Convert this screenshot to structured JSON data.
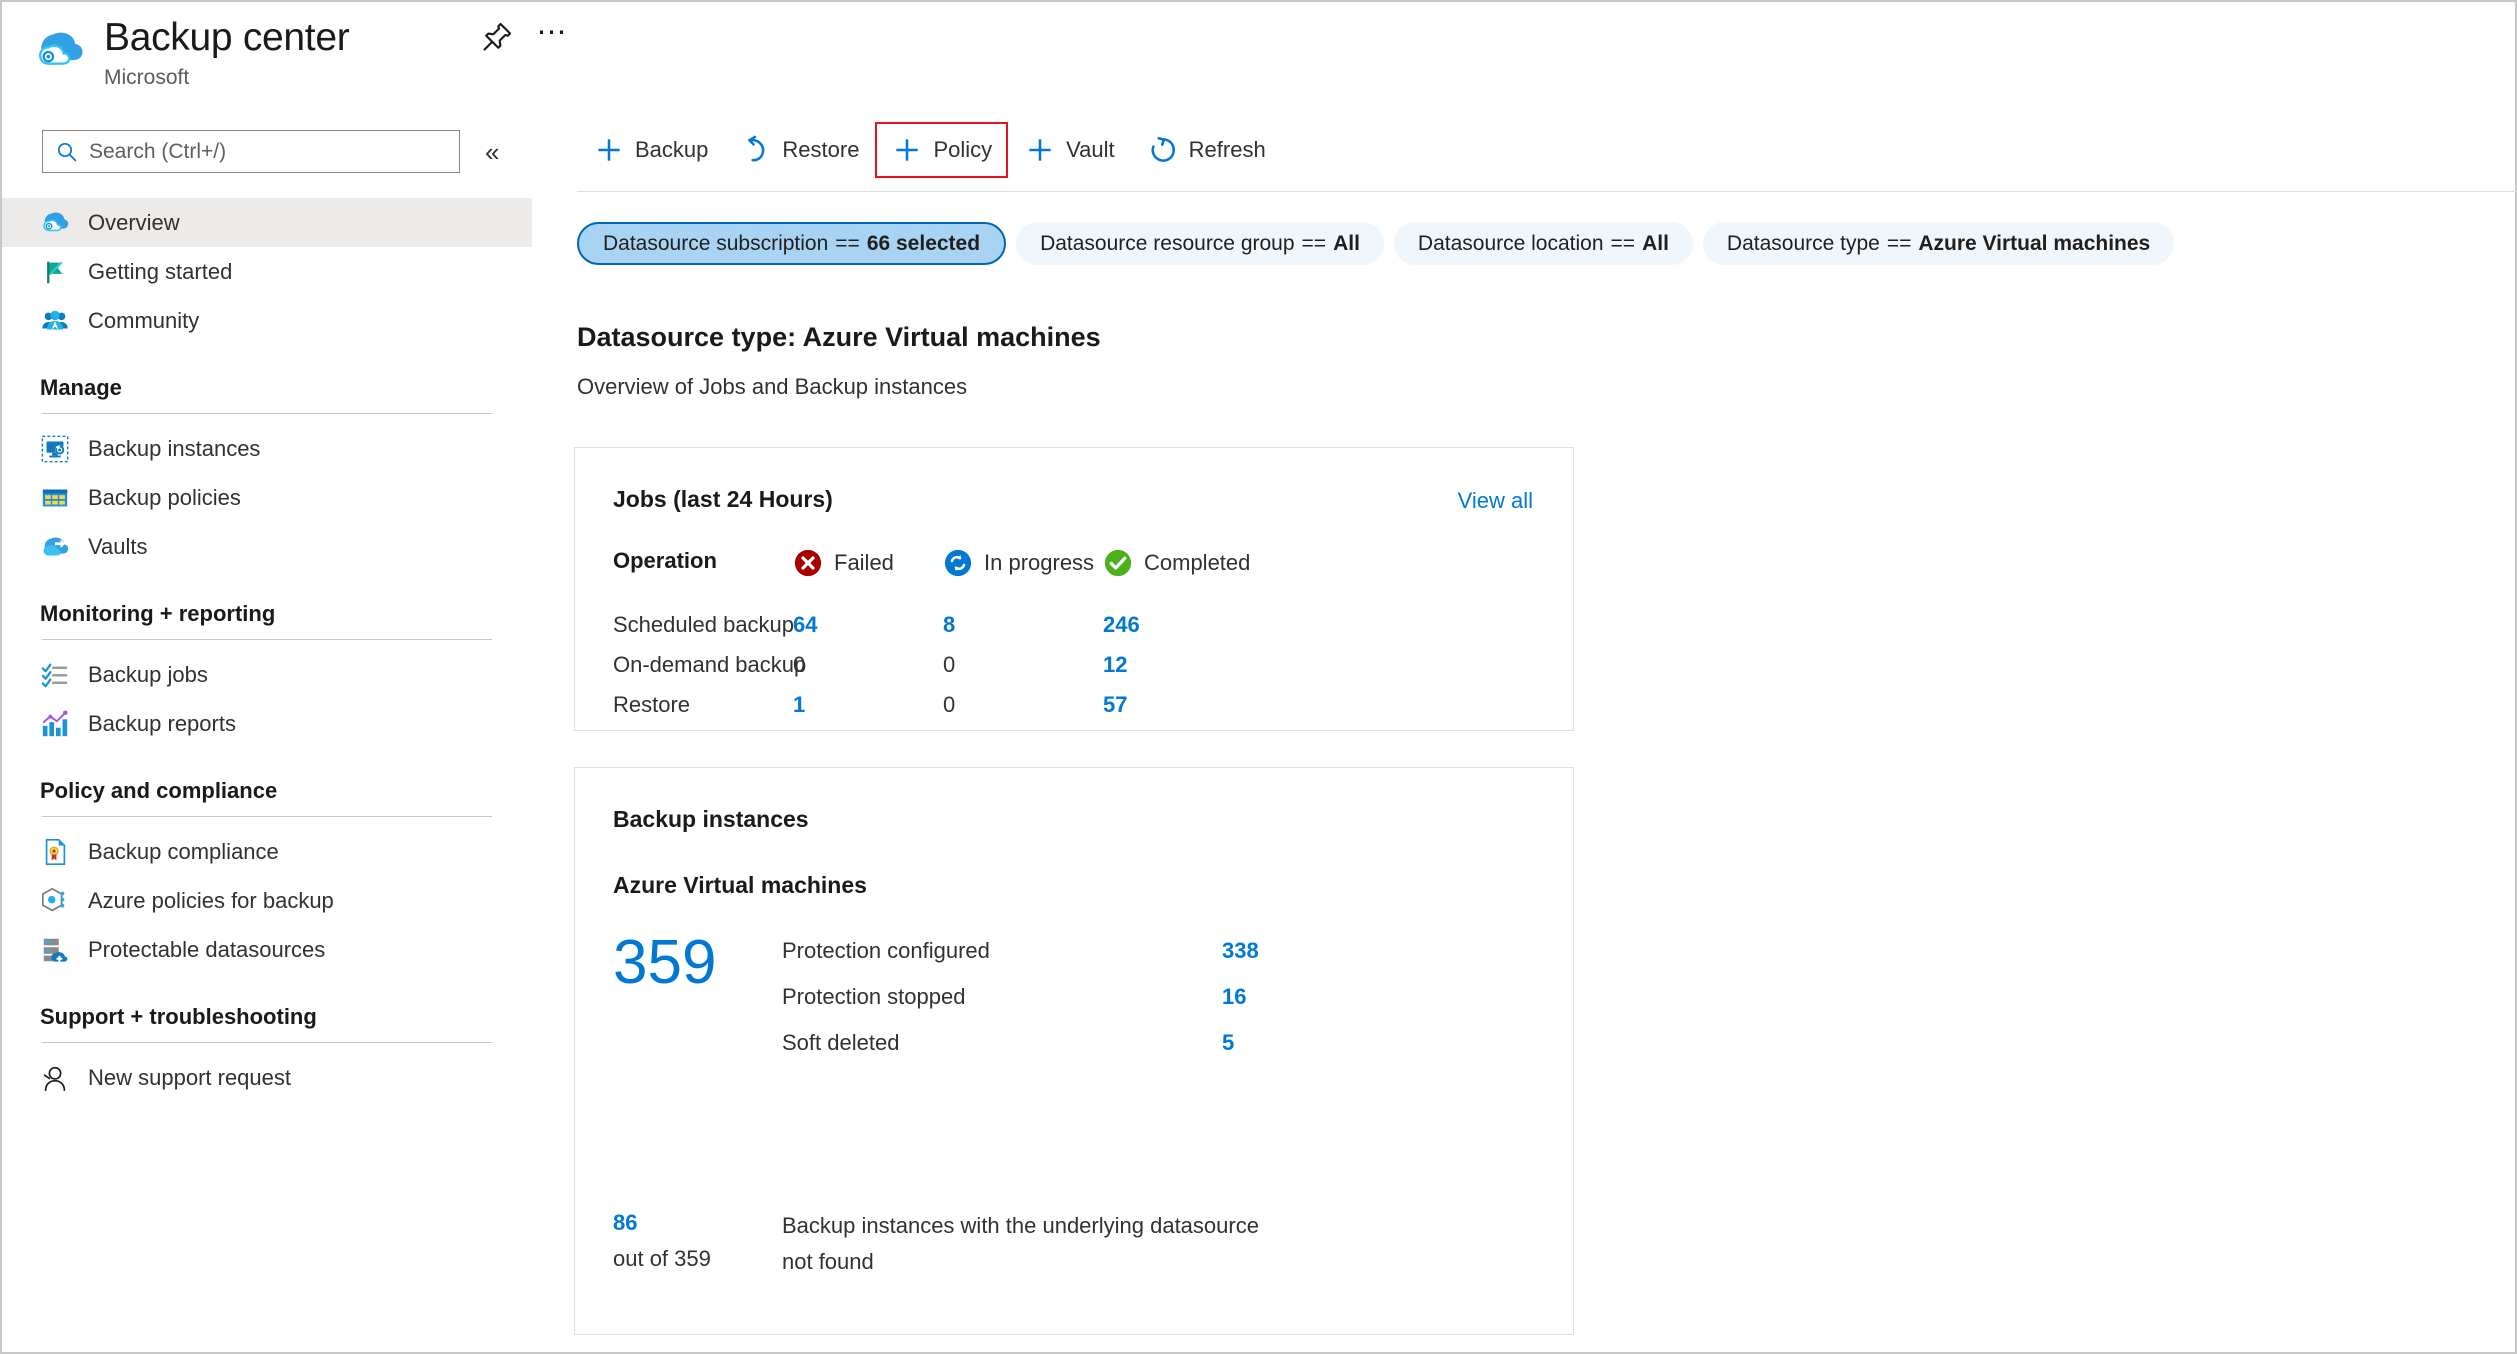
{
  "header": {
    "title": "Backup center",
    "subtitle": "Microsoft",
    "pin_icon": "pin-icon",
    "more_icon": "more-options-icon"
  },
  "search": {
    "placeholder": "Search (Ctrl+/)",
    "value": "",
    "icon": "search-icon",
    "collapse_label": "«"
  },
  "sidebar": {
    "items": [
      {
        "label": "Overview",
        "icon": "cloud-backup-icon",
        "selected": true
      },
      {
        "label": "Getting started",
        "icon": "flag-icon",
        "selected": false
      },
      {
        "label": "Community",
        "icon": "people-icon",
        "selected": false
      }
    ],
    "groups": [
      {
        "title": "Manage",
        "items": [
          {
            "label": "Backup instances",
            "icon": "backup-instance-icon"
          },
          {
            "label": "Backup policies",
            "icon": "table-grid-icon"
          },
          {
            "label": "Vaults",
            "icon": "vault-cloud-icon"
          }
        ]
      },
      {
        "title": "Monitoring + reporting",
        "items": [
          {
            "label": "Backup jobs",
            "icon": "checklist-icon"
          },
          {
            "label": "Backup reports",
            "icon": "bar-chart-icon"
          }
        ]
      },
      {
        "title": "Policy and compliance",
        "items": [
          {
            "label": "Backup compliance",
            "icon": "certificate-document-icon"
          },
          {
            "label": "Azure policies for backup",
            "icon": "policy-hex-icon"
          },
          {
            "label": "Protectable datasources",
            "icon": "server-add-icon"
          }
        ]
      },
      {
        "title": "Support + troubleshooting",
        "items": [
          {
            "label": "New support request",
            "icon": "person-support-icon"
          }
        ]
      }
    ]
  },
  "toolbar": {
    "buttons": [
      {
        "label": "Backup",
        "icon": "plus-icon",
        "highlighted": false
      },
      {
        "label": "Restore",
        "icon": "undo-icon",
        "highlighted": false
      },
      {
        "label": "Policy",
        "icon": "plus-icon",
        "highlighted": true
      },
      {
        "label": "Vault",
        "icon": "plus-icon",
        "highlighted": false
      },
      {
        "label": "Refresh",
        "icon": "refresh-icon",
        "highlighted": false
      }
    ],
    "highlight_color": "#e81123"
  },
  "filters": [
    {
      "name": "Datasource subscription",
      "operator": "==",
      "value": "66 selected",
      "active": true
    },
    {
      "name": "Datasource resource group",
      "operator": "==",
      "value": "All",
      "active": false
    },
    {
      "name": "Datasource location",
      "operator": "==",
      "value": "All",
      "active": false
    },
    {
      "name": "Datasource type",
      "operator": "==",
      "value": "Azure Virtual machines",
      "active": false
    }
  ],
  "page": {
    "title": "Datasource type: Azure Virtual machines",
    "subtitle": "Overview of Jobs and Backup instances"
  },
  "jobs_card": {
    "title": "Jobs (last 24 Hours)",
    "view_all": "View all",
    "columns": [
      {
        "label": "Operation",
        "icon": null
      },
      {
        "label": "Failed",
        "icon": "error-circle-icon"
      },
      {
        "label": "In progress",
        "icon": "sync-circle-icon"
      },
      {
        "label": "Completed",
        "icon": "check-circle-icon"
      }
    ],
    "rows": [
      {
        "operation": "Scheduled backup",
        "failed": "64",
        "in_progress": "8",
        "completed": "246"
      },
      {
        "operation": "On-demand backup",
        "failed": "0",
        "in_progress": "0",
        "completed": "12"
      },
      {
        "operation": "Restore",
        "failed": "1",
        "in_progress": "0",
        "completed": "57"
      }
    ]
  },
  "instances_card": {
    "title": "Backup instances",
    "subtitle": "Azure Virtual machines",
    "total": "359",
    "breakdown": [
      {
        "label": "Protection configured",
        "value": "338"
      },
      {
        "label": "Protection stopped",
        "value": "16"
      },
      {
        "label": "Soft deleted",
        "value": "5"
      }
    ],
    "footer": {
      "count": "86",
      "out_of": "out of 359",
      "text": "Backup instances with the underlying datasource not found"
    }
  },
  "colors": {
    "accent_link": "#0078d4",
    "failed": "#a80000",
    "in_progress": "#0078d4",
    "completed": "#107c10",
    "pill_active_bg": "#a9d3f2",
    "pill_bg": "#eff6fc",
    "selected_nav_bg": "#edebe9"
  }
}
